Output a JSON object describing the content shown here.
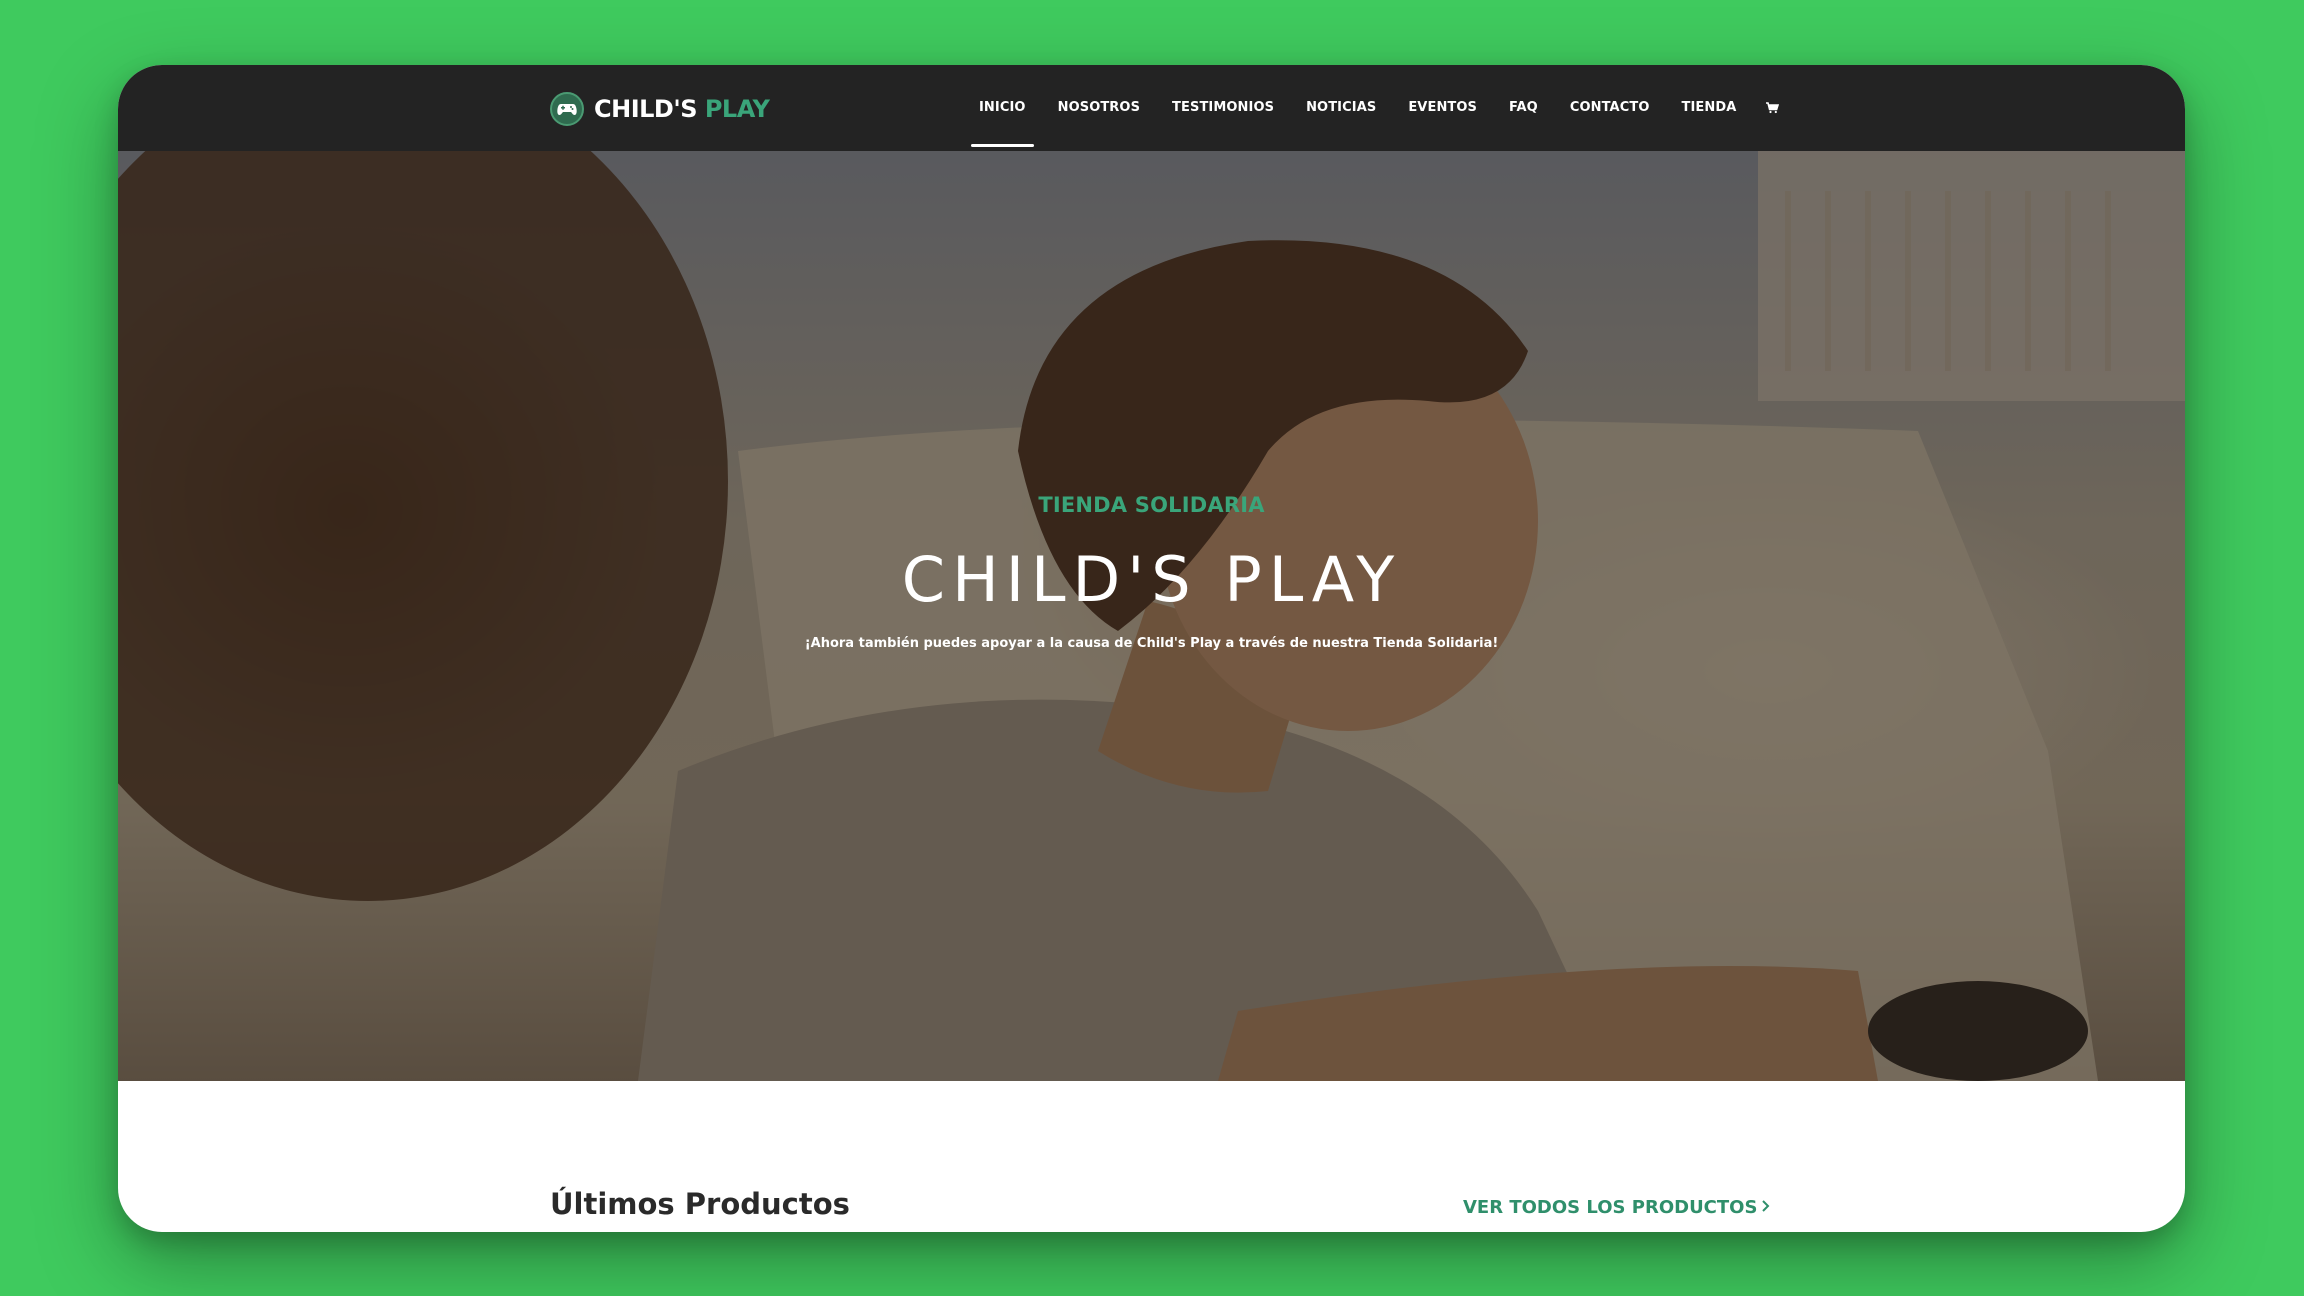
{
  "logo": {
    "text_main": "CHILD'S",
    "text_accent": "PLAY",
    "icon": "gamepad-logo-icon"
  },
  "nav": {
    "items": [
      {
        "label": "INICIO",
        "active": true
      },
      {
        "label": "NOSOTROS",
        "active": false
      },
      {
        "label": "TESTIMONIOS",
        "active": false
      },
      {
        "label": "NOTICIAS",
        "active": false
      },
      {
        "label": "EVENTOS",
        "active": false
      },
      {
        "label": "FAQ",
        "active": false
      },
      {
        "label": "CONTACTO",
        "active": false
      },
      {
        "label": "TIENDA",
        "active": false
      }
    ],
    "cart_icon": "cart-icon"
  },
  "hero": {
    "eyebrow": "TIENDA SOLIDARIA",
    "title": "CHILD'S PLAY",
    "subtitle": "¡Ahora también puedes apoyar a la causa de Child's Play a través de nuestra Tienda Solidaria!"
  },
  "products": {
    "heading": "Últimos Productos",
    "link_label": "VER TODOS LOS PRODUCTOS",
    "link_icon": "chevron-right-icon"
  },
  "colors": {
    "page_background": "#3fca5e",
    "navbar": "#232323",
    "accent": "#3aa57a",
    "link": "#2f8f6b"
  }
}
